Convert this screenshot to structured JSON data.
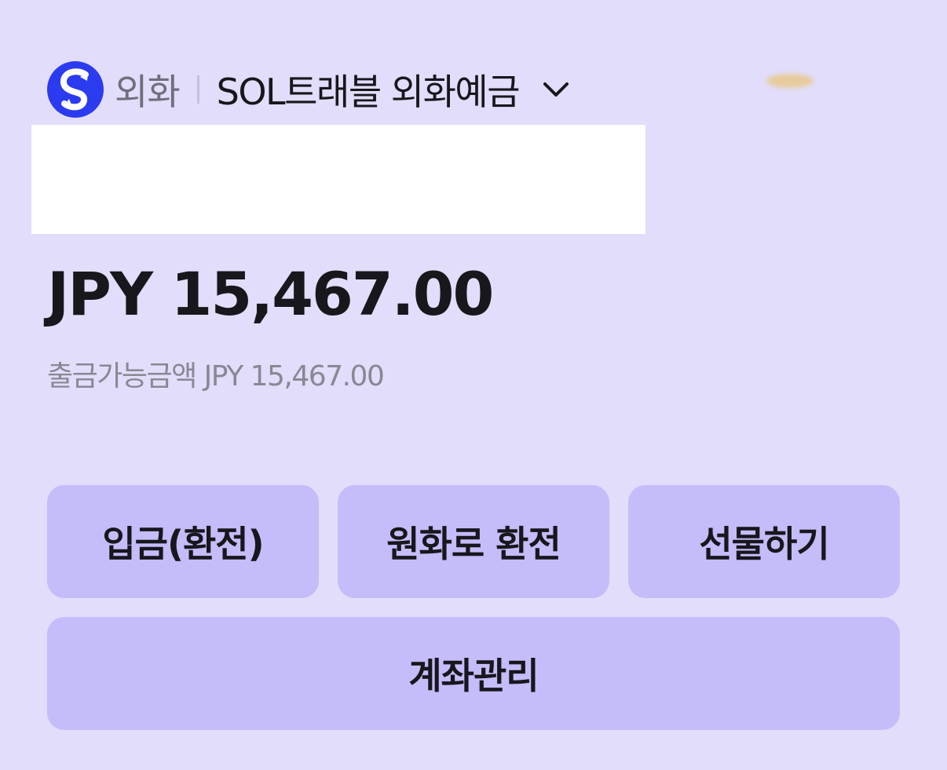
{
  "header": {
    "logo_icon": "shinhan-s-logo-icon",
    "category": "외화",
    "product_name": "SOL트래블 외화예금",
    "dropdown_icon": "chevron-down-icon"
  },
  "balance": {
    "amount": "JPY 15,467.00",
    "available_label": "출금가능금액 JPY 15,467.00"
  },
  "actions": {
    "deposit": "입금(환전)",
    "convert_to_won": "원화로 환전",
    "gift": "선물하기",
    "manage_account": "계좌관리"
  },
  "colors": {
    "background": "#E2DDFA",
    "button": "#C5BCFA",
    "brand": "#2B3BF0",
    "text": "#17171C",
    "muted": "#8A8794"
  }
}
